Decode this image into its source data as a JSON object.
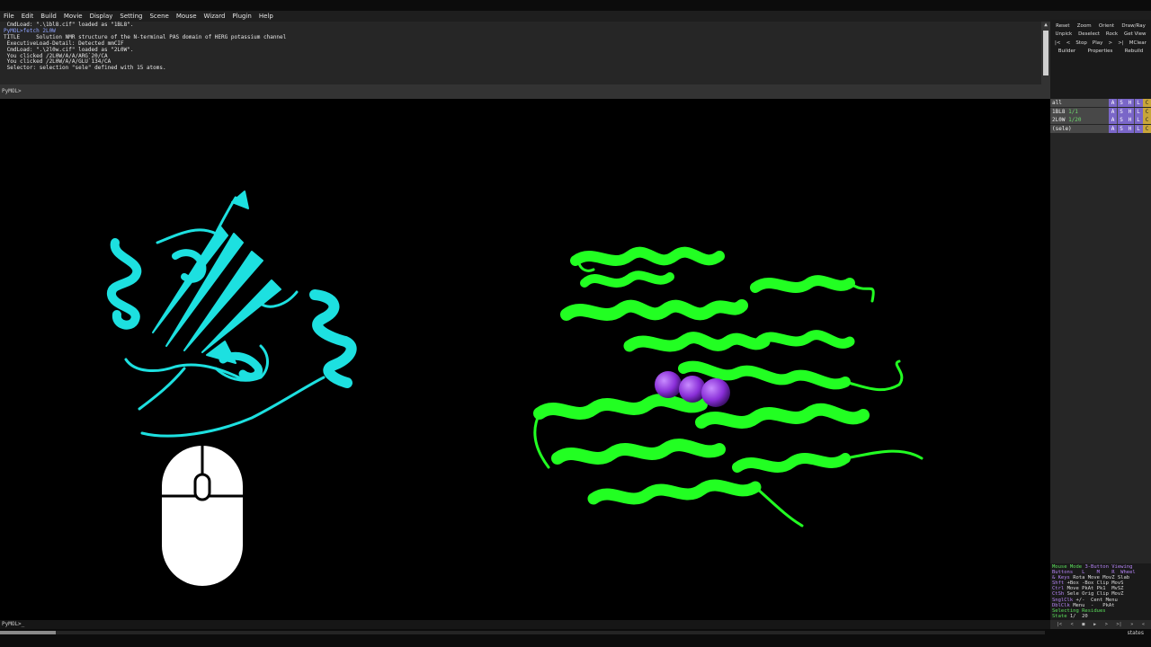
{
  "menu": [
    "File",
    "Edit",
    "Build",
    "Movie",
    "Display",
    "Setting",
    "Scene",
    "Mouse",
    "Wizard",
    "Plugin",
    "Help"
  ],
  "console_lines": [
    {
      "text": " CmdLoad: \".\\1bl8.cif\" loaded as \"1BL8\".",
      "prompt": false
    },
    {
      "text": "PyMOL>fetch 2L0W",
      "prompt": true
    },
    {
      "text": "TITLE     Solution NMR structure of the N-terminal PAS domain of HERG potassium channel",
      "prompt": false
    },
    {
      "text": " ExecutiveLoad-Detail: Detected mmCIF",
      "prompt": false
    },
    {
      "text": " CmdLoad: \".\\2l0w.cif\" loaded as \"2L0W\".",
      "prompt": false
    },
    {
      "text": " You clicked /2L0W/A/A/ARG`20/CA",
      "prompt": false
    },
    {
      "text": " You clicked /2L0W/A/A/GLU`134/CA",
      "prompt": false
    },
    {
      "text": " Selector: selection \"sele\" defined with 15 atoms.",
      "prompt": false
    }
  ],
  "command_prompt": "PyMOL>",
  "bottom_prompt": "PyMOL>_",
  "controls": {
    "row1": [
      "Reset",
      "Zoom",
      "Orient",
      "Draw/Ray"
    ],
    "row2": [
      "Unpick",
      "Deselect",
      "Rock",
      "Get View"
    ],
    "row3": [
      "|<",
      "<",
      "Stop",
      "Play",
      ">",
      ">|",
      "MClear"
    ],
    "row4": [
      "Builder",
      "Properties",
      "Rebuild"
    ]
  },
  "objects": [
    {
      "name": "all",
      "count": ""
    },
    {
      "name": "1BL8",
      "count": "1/1"
    },
    {
      "name": "2L0W",
      "count": "1/20"
    },
    {
      "name": "(sele)",
      "count": ""
    }
  ],
  "object_buttons": [
    "A",
    "S",
    "H",
    "L",
    "C"
  ],
  "mouse_panel": {
    "title": "Mouse Mode",
    "mode": "3-Button Viewing",
    "header": "Buttons   L    M    R  Wheel",
    "keys_label": "& Keys",
    "keys_row": "Rota Move MovZ Slab",
    "rows": [
      {
        "key": "Shft",
        "val": "+Box -Box Clip MovS"
      },
      {
        "key": "Ctrl",
        "val": "Move PkAt Pk1  MvSZ"
      },
      {
        "key": "CtSh",
        "val": "Sele Orig Clip MovZ"
      },
      {
        "key": "SnglClk",
        "val": "+/-  Cent Menu"
      },
      {
        "key": "DblClk",
        "val": "Menu  -   PkAt"
      }
    ],
    "selecting": "Selecting Residues",
    "state_label": "State",
    "state_value": "1/  20"
  },
  "bottom_controls": [
    "|<",
    "<",
    "■",
    "▶",
    ">",
    ">|",
    "»",
    "«"
  ],
  "status_right": "states",
  "colors": {
    "helix_1bl8": "#22ff22",
    "helix_2l0w": "#1de0e0",
    "sphere": "#8a2fd8",
    "mouse_icon": "#ffffff"
  },
  "icons": {
    "mouse": "mouse-icon"
  }
}
